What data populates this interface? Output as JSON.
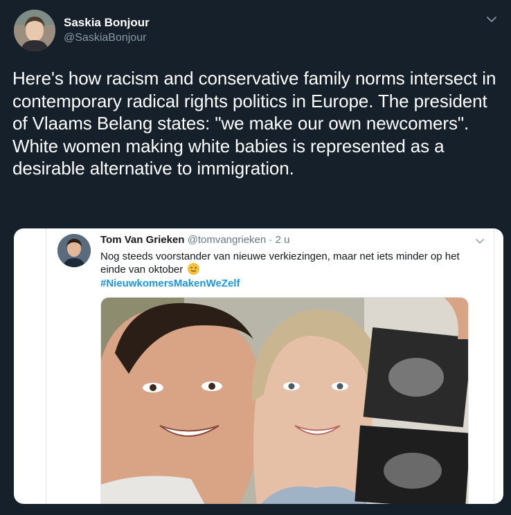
{
  "author": {
    "display_name": "Saskia Bonjour",
    "handle": "@SaskiaBonjour"
  },
  "tweet": {
    "text": "Here's how racism and conservative family norms intersect in contemporary radical rights politics in Europe. The president of Vlaams Belang states: \"we make our own newcomers\". White women making white babies is represented as a desirable alternative to immigration."
  },
  "quoted": {
    "display_name": "Tom Van Grieken",
    "handle": "@tomvangrieken",
    "separator": "·",
    "time": "2 u",
    "text": "Nog steeds voorstander van nieuwe verkiezingen, maar net iets minder op het einde van oktober",
    "emoji": "winking-face-emoji",
    "hashtag": "#NieuwkomersMakenWeZelf"
  },
  "colors": {
    "background": "#15202b",
    "secondary_text": "#8899a6",
    "link": "#1b95e0"
  }
}
